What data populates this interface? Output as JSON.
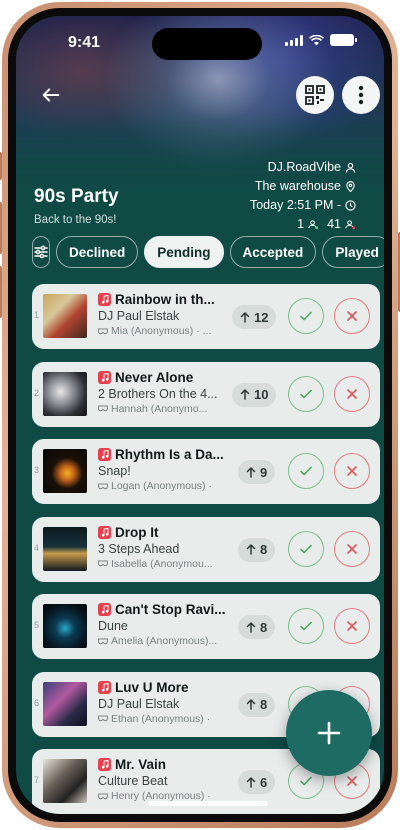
{
  "status_bar": {
    "time": "9:41"
  },
  "event": {
    "title": "90s Party",
    "subtitle": "Back to the 90s!",
    "dj_name": "DJ.RoadVibe",
    "location": "The warehouse",
    "time_range": "Today 2:51 PM -",
    "online_count": "1",
    "offline_count": "41"
  },
  "tabs": [
    {
      "label": "Declined"
    },
    {
      "label": "Pending",
      "active": true
    },
    {
      "label": "Accepted"
    },
    {
      "label": "Played"
    }
  ],
  "requests": [
    {
      "rank": "1",
      "title": "Rainbow in th...",
      "artist": "DJ Paul Elstak",
      "requester": "Mia (Anonymous) · ...",
      "votes": "12"
    },
    {
      "rank": "2",
      "title": "Never Alone",
      "artist": "2 Brothers On the 4...",
      "requester": "Hannah (Anonymo...",
      "votes": "10"
    },
    {
      "rank": "3",
      "title": "Rhythm Is a Da...",
      "artist": "Snap!",
      "requester": "Logan (Anonymous) ·",
      "votes": "9"
    },
    {
      "rank": "4",
      "title": "Drop It",
      "artist": "3 Steps Ahead",
      "requester": "Isabella (Anonymou...",
      "votes": "8"
    },
    {
      "rank": "5",
      "title": "Can't Stop Ravi...",
      "artist": "Dune",
      "requester": "Amelia (Anonymous)...",
      "votes": "8"
    },
    {
      "rank": "6",
      "title": "Luv U More",
      "artist": "DJ Paul Elstak",
      "requester": "Ethan (Anonymous) ·",
      "votes": "8"
    },
    {
      "rank": "7",
      "title": "Mr. Vain",
      "artist": "Culture Beat",
      "requester": "Henry (Anonymous) ·",
      "votes": "6"
    }
  ],
  "colors": {
    "accent": "#1e6b64",
    "background": "#0f4a45",
    "accept": "#7cc08e",
    "decline": "#e6797c",
    "music_badge": "#e6404f"
  },
  "icons": {
    "back": "arrow-left-icon",
    "qr": "qr-code-icon",
    "more": "more-vertical-icon",
    "add": "plus-icon"
  }
}
